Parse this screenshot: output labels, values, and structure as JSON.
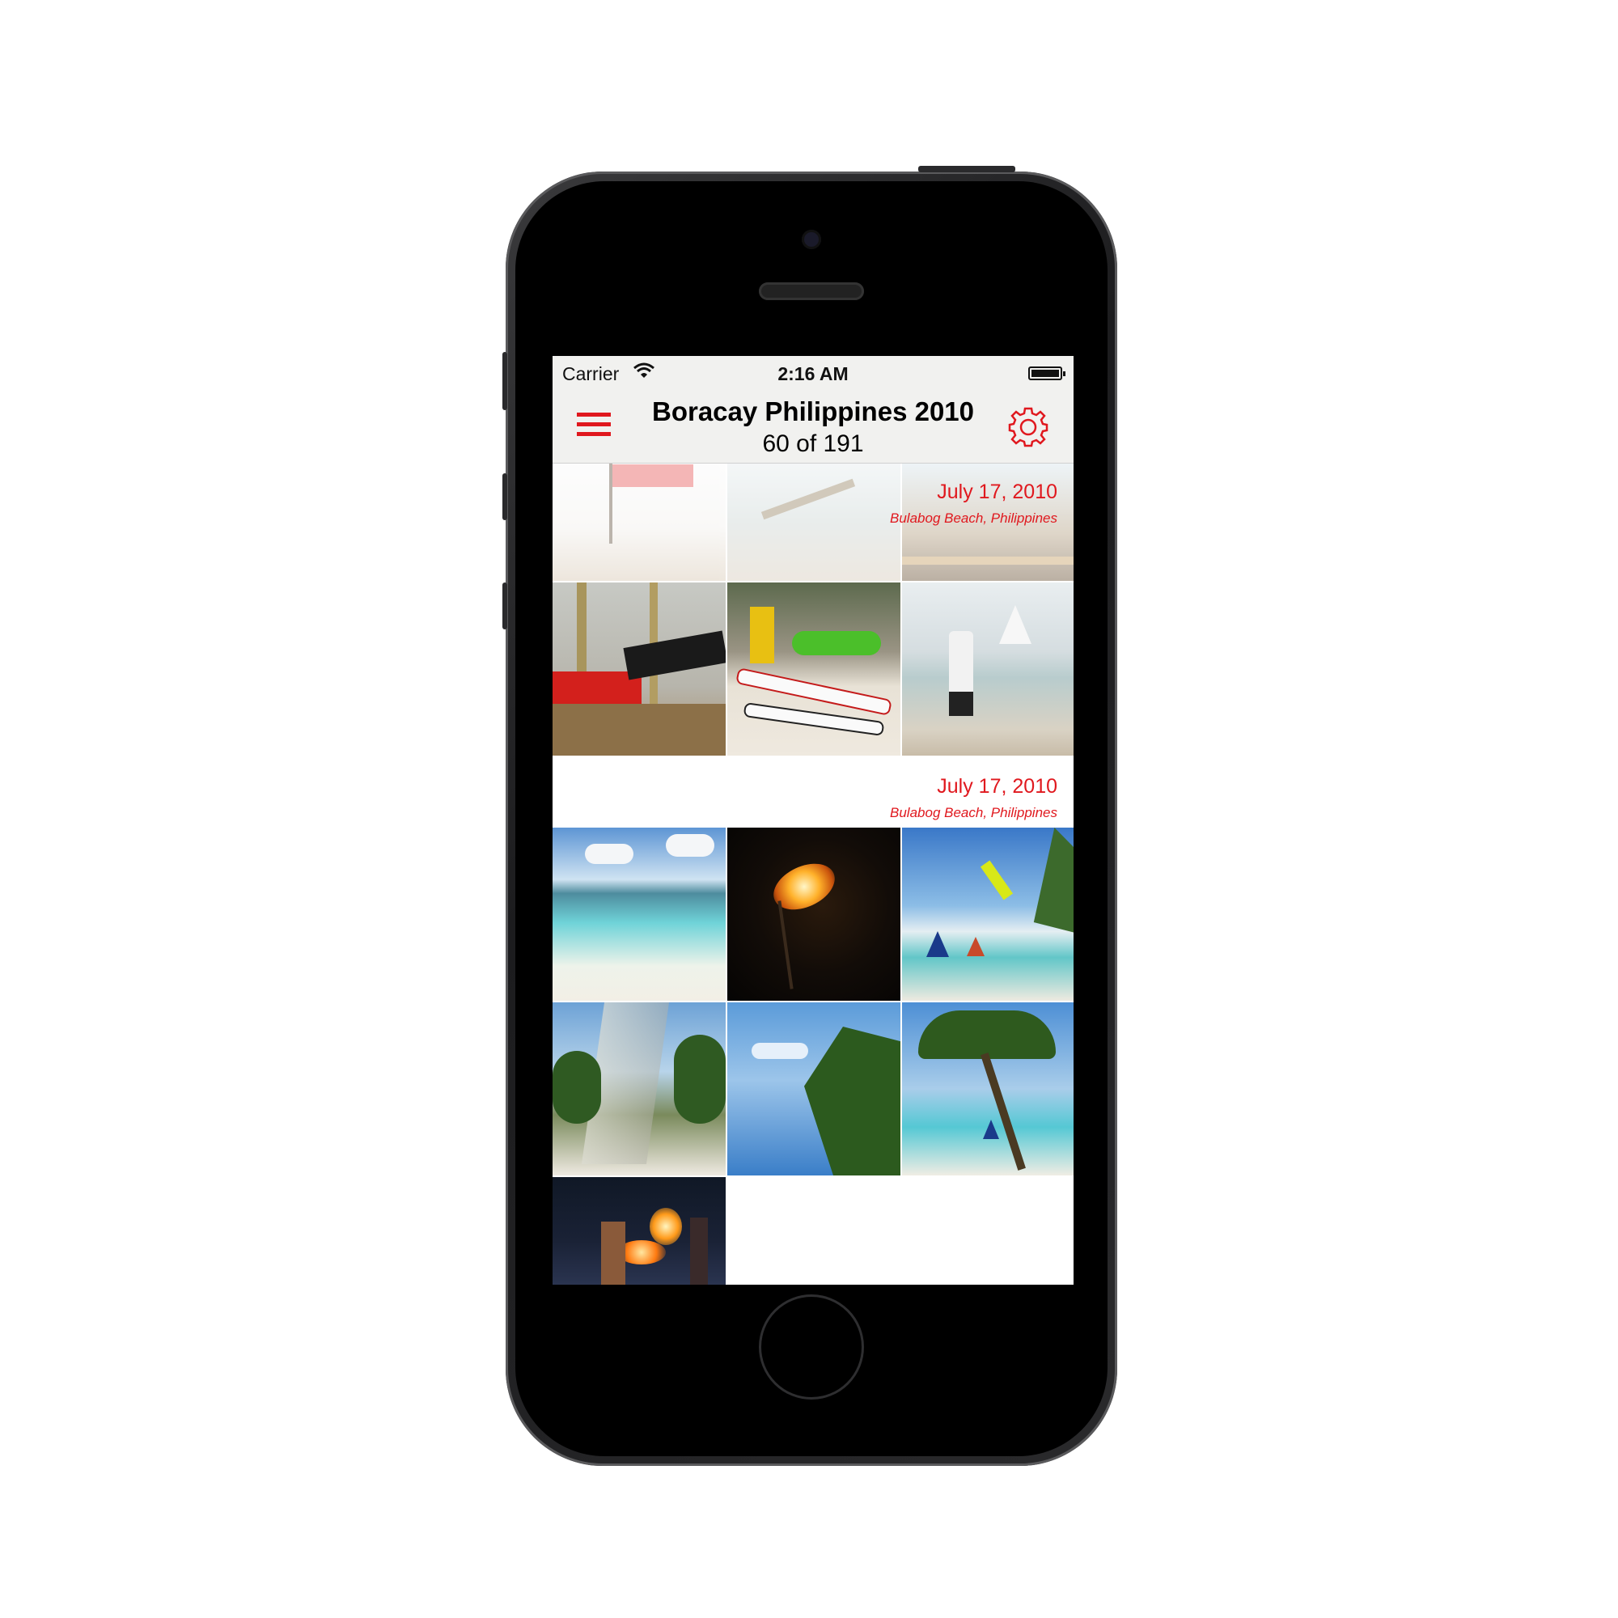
{
  "status_bar": {
    "carrier": "Carrier",
    "time": "2:16 AM"
  },
  "header": {
    "title": "Boracay Philippines 2010",
    "subtitle": "60 of 191"
  },
  "sections": [
    {
      "date": "July 17, 2010",
      "location": "Bulabog Beach, Philippines"
    },
    {
      "date": "July 17, 2010",
      "location": "Bulabog Beach, Philippines"
    }
  ],
  "colors": {
    "accent": "#e0181e"
  },
  "icons": {
    "menu": "hamburger-menu-icon",
    "settings": "gear-icon",
    "wifi": "wifi-icon",
    "battery": "battery-icon"
  }
}
